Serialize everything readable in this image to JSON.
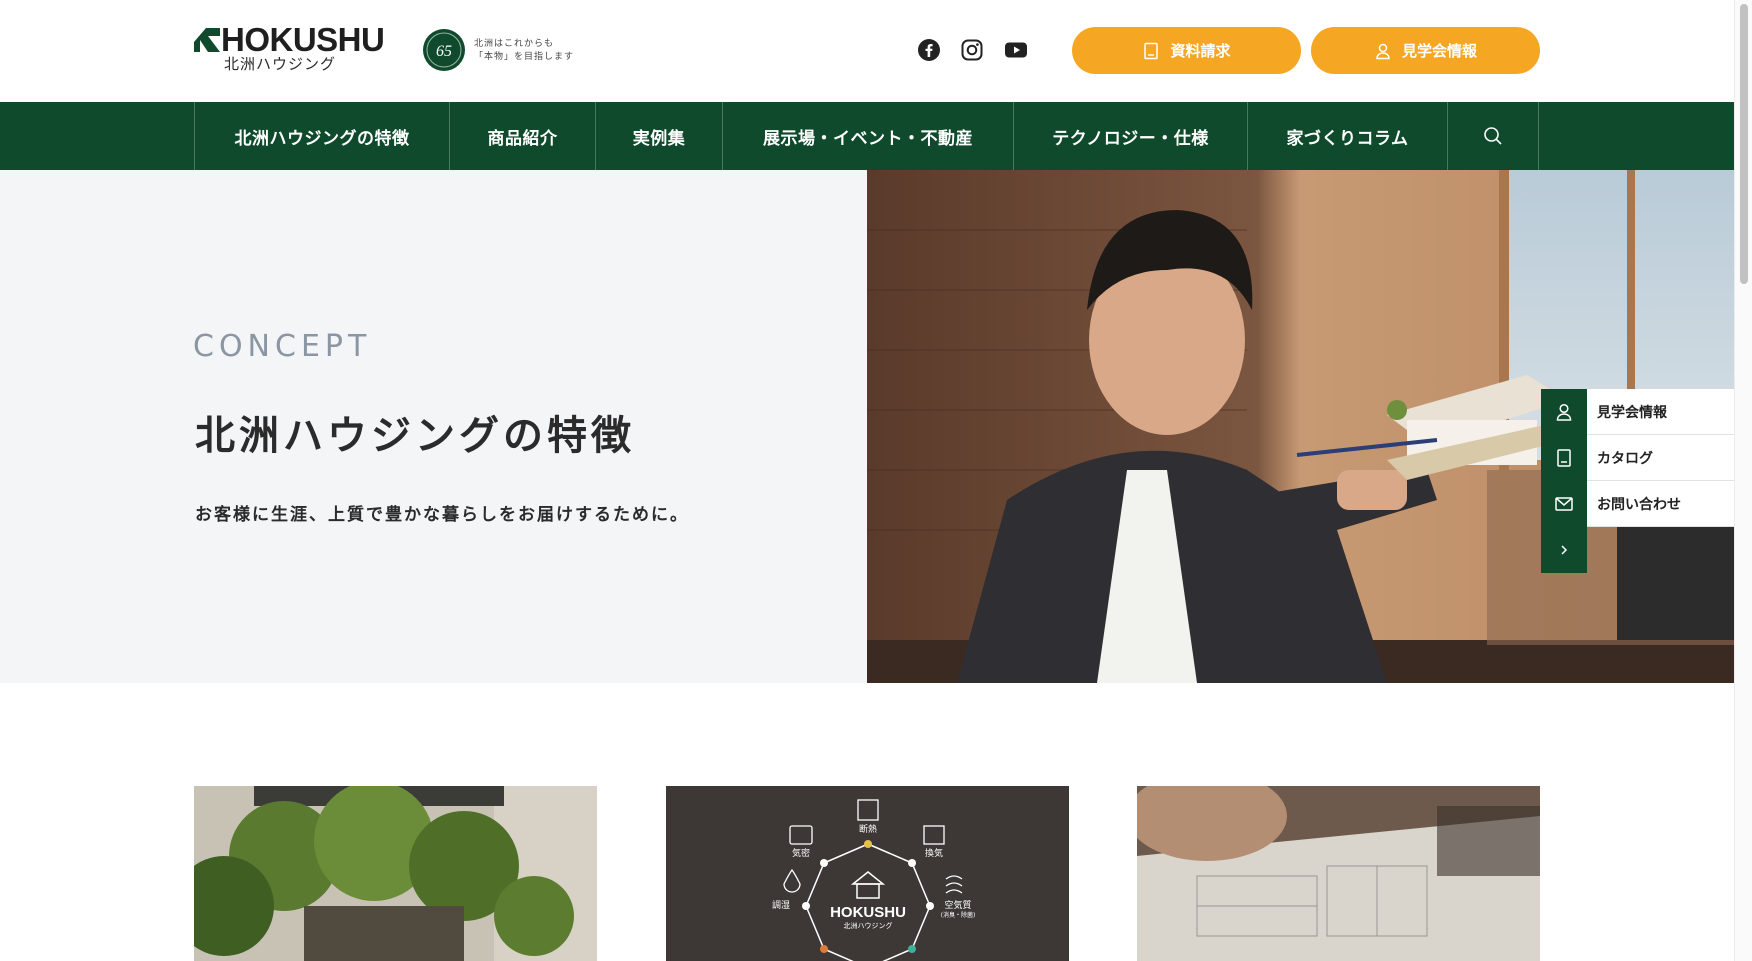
{
  "header": {
    "logo_word": "HOKUSHU",
    "logo_sub": "北洲ハウジング",
    "badge_number": "65",
    "tagline_line1": "北洲はこれからも",
    "tagline_line2": "「本物」を目指します",
    "sns": [
      {
        "icon": "facebook-icon"
      },
      {
        "icon": "instagram-icon"
      },
      {
        "icon": "youtube-icon"
      }
    ],
    "cta_catalog": "資料請求",
    "cta_tour": "見学会情報",
    "accent_color": "#f5a623"
  },
  "nav": {
    "items": [
      "北洲ハウジングの特徴",
      "商品紹介",
      "実例集",
      "展示場・イベント・不動産",
      "テクノロジー・仕様",
      "家づくりコラム"
    ],
    "search_icon": "search-icon",
    "bg_color": "#0e4a2b"
  },
  "hero": {
    "eyebrow": "CONCEPT",
    "title": "北洲ハウジングの特徴",
    "lead": "お客様に生涯、上質で豊かな暮らしをお届けするために。"
  },
  "side_menu": {
    "items": [
      {
        "icon": "person-icon",
        "label": "見学会情報"
      },
      {
        "icon": "book-icon",
        "label": "カタログ"
      },
      {
        "icon": "mail-icon",
        "label": "お問い合わせ"
      }
    ],
    "toggle_icon": "chevron-right-icon"
  },
  "cards": {
    "diagram": {
      "center_word": "HOKUSHU",
      "center_sub": "北洲ハウジング",
      "labels": [
        "断熱",
        "換気",
        "空気質",
        "(消臭・除菌)",
        "気密",
        "調湿"
      ]
    }
  }
}
